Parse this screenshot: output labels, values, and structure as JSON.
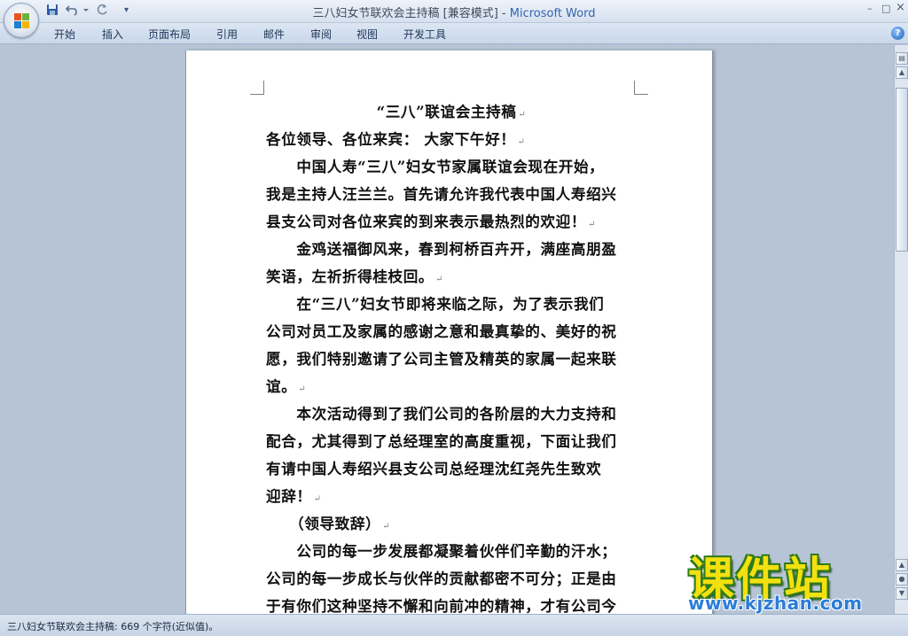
{
  "window": {
    "title_doc": "三八妇女节联欢会主持稿 [兼容模式] - ",
    "title_app": "Microsoft Word",
    "min_glyph": "–",
    "max_glyph": "□",
    "close_glyph": "×"
  },
  "quick_access": {
    "save_icon": "save-icon",
    "undo_icon": "undo-icon",
    "redo_icon": "redo-icon",
    "customize_glyph": "▾"
  },
  "ribbon": {
    "tabs": [
      "开始",
      "插入",
      "页面布局",
      "引用",
      "邮件",
      "审阅",
      "视图",
      "开发工具"
    ],
    "help_glyph": "?"
  },
  "document": {
    "pilcrow": "↵",
    "lines": [
      "“三八”联谊会主持稿",
      "各位领导、各位来宾： 大家下午好！",
      "　　中国人寿“三八”妇女节家属联谊会现在开始，",
      "我是主持人汪兰兰。首先请允许我代表中国人寿绍兴",
      "县支公司对各位来宾的到来表示最热烈的欢迎！",
      "　　金鸡送福御风来，春到柯桥百卉开，满座高朋盈",
      "笑语，左祈折得桂枝回。",
      "　　在“三八”妇女节即将来临之际，为了表示我们",
      "公司对员工及家属的感谢之意和最真挚的、美好的祝",
      "愿，我们特别邀请了公司主管及精英的家属一起来联",
      "谊。",
      "　　本次活动得到了我们公司的各阶层的大力支持和",
      "配合，尤其得到了总经理室的高度重视，下面让我们",
      "有请中国人寿绍兴县支公司总经理沈红尧先生致欢",
      "迎辞！",
      "　　（领导致辞）",
      "　　公司的每一步发展都凝聚着伙伴们辛勤的汗水；",
      "公司的每一步成长与伙伴的贡献都密不可分；正是由",
      "于有你们这种坚持不懈和向前冲的精神，才有公司今"
    ]
  },
  "statusbar": {
    "text": "三八妇女节联欢会主持稿: 669 个字符(近似值)。"
  },
  "watermark": {
    "chinese": "课件站",
    "url": "www.kjzhan.com"
  },
  "colors": {
    "title_app": "#3166b0",
    "watermark_fill": "#f3e010",
    "watermark_stroke": "#2f7a1a",
    "watermark_url": "#2b7dd8"
  }
}
